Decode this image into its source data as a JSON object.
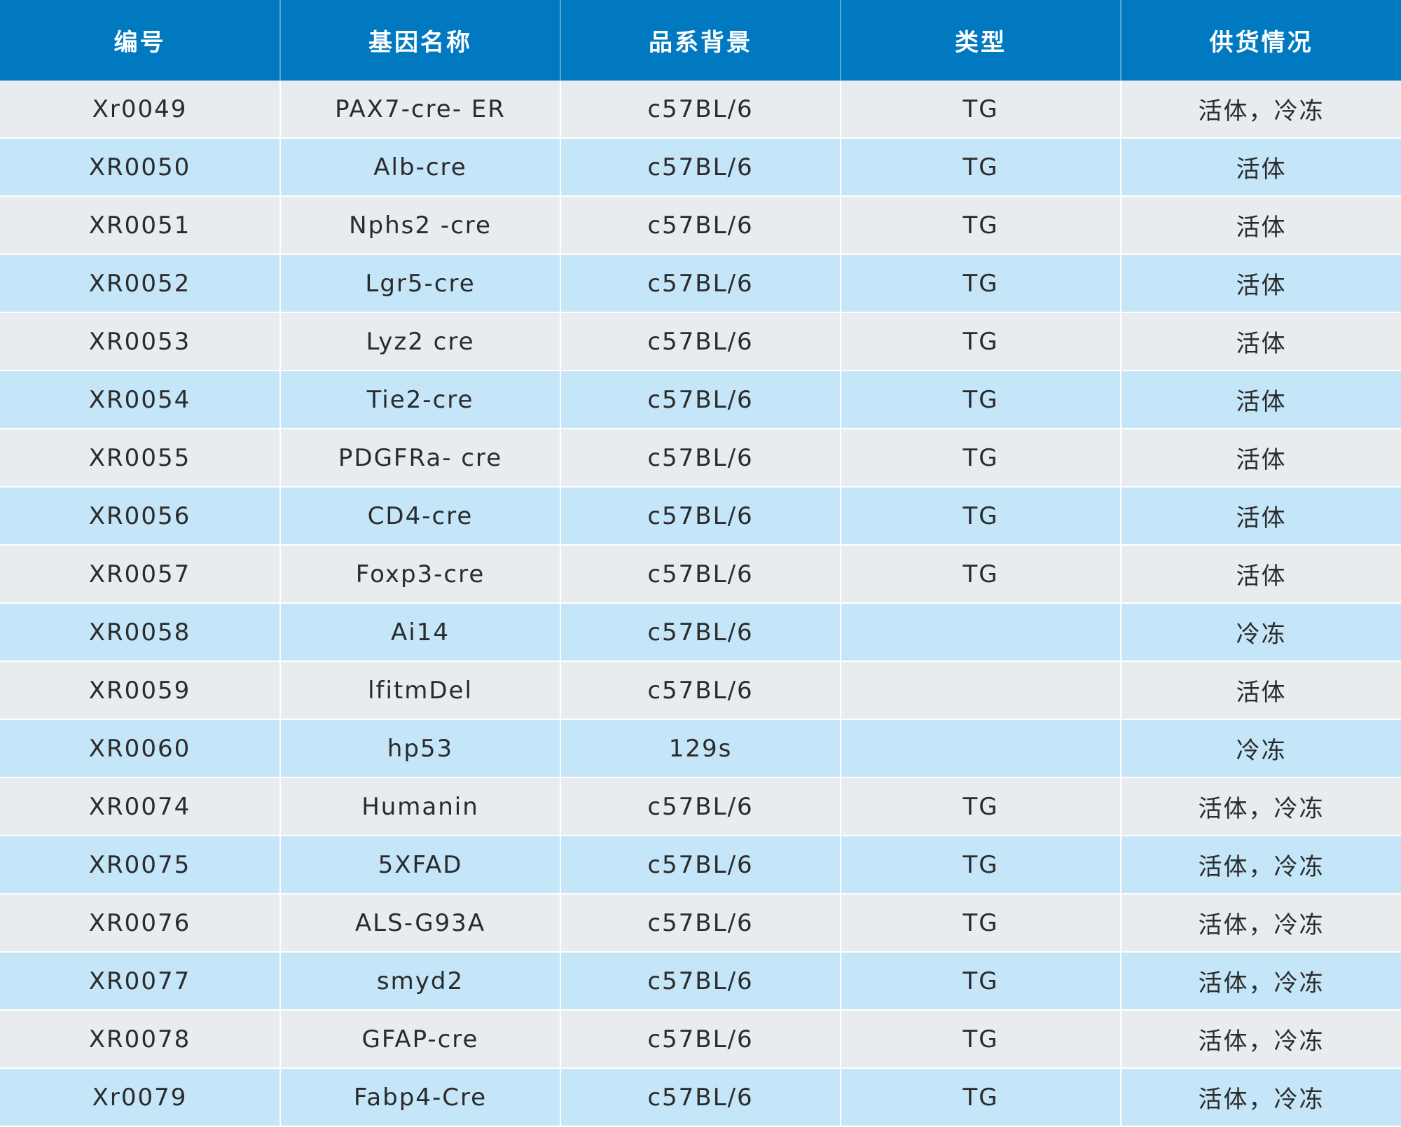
{
  "table": {
    "headers": [
      "编号",
      "基因名称",
      "品系背景",
      "类型",
      "供货情况"
    ],
    "rows": [
      [
        "Xr0049",
        "PAX7-cre- ER",
        "c57BL/6",
        "TG",
        "活体，冷冻"
      ],
      [
        "XR0050",
        "Alb-cre",
        "c57BL/6",
        "TG",
        "活体"
      ],
      [
        "XR0051",
        "Nphs2 -cre",
        "c57BL/6",
        "TG",
        "活体"
      ],
      [
        "XR0052",
        "Lgr5-cre",
        "c57BL/6",
        "TG",
        "活体"
      ],
      [
        "XR0053",
        "Lyz2 cre",
        "c57BL/6",
        "TG",
        "活体"
      ],
      [
        "XR0054",
        "Tie2-cre",
        "c57BL/6",
        "TG",
        "活体"
      ],
      [
        "XR0055",
        "PDGFRa- cre",
        "c57BL/6",
        "TG",
        "活体"
      ],
      [
        "XR0056",
        "CD4-cre",
        "c57BL/6",
        "TG",
        "活体"
      ],
      [
        "XR0057",
        "Foxp3-cre",
        "c57BL/6",
        "TG",
        "活体"
      ],
      [
        "XR0058",
        "Ai14",
        "c57BL/6",
        "",
        "冷冻"
      ],
      [
        "XR0059",
        "lfitmDel",
        "c57BL/6",
        "",
        "活体"
      ],
      [
        "XR0060",
        "hp53",
        "129s",
        "",
        "冷冻"
      ],
      [
        "XR0074",
        "Humanin",
        "c57BL/6",
        "TG",
        "活体，冷冻"
      ],
      [
        "XR0075",
        "5XFAD",
        "c57BL/6",
        "TG",
        "活体，冷冻"
      ],
      [
        "XR0076",
        "ALS-G93A",
        "c57BL/6",
        "TG",
        "活体，冷冻"
      ],
      [
        "XR0077",
        "smyd2",
        "c57BL/6",
        "TG",
        "活体，冷冻"
      ],
      [
        "XR0078",
        "GFAP-cre",
        "c57BL/6",
        "TG",
        "活体，冷冻"
      ],
      [
        "Xr0079",
        "Fabp4-Cre",
        "c57BL/6",
        "TG",
        "活体，冷冻"
      ]
    ]
  },
  "colors": {
    "header_bg": "#0079c1",
    "row_odd_bg": "#e9ecef",
    "row_even_bg": "#c5e5f8"
  }
}
